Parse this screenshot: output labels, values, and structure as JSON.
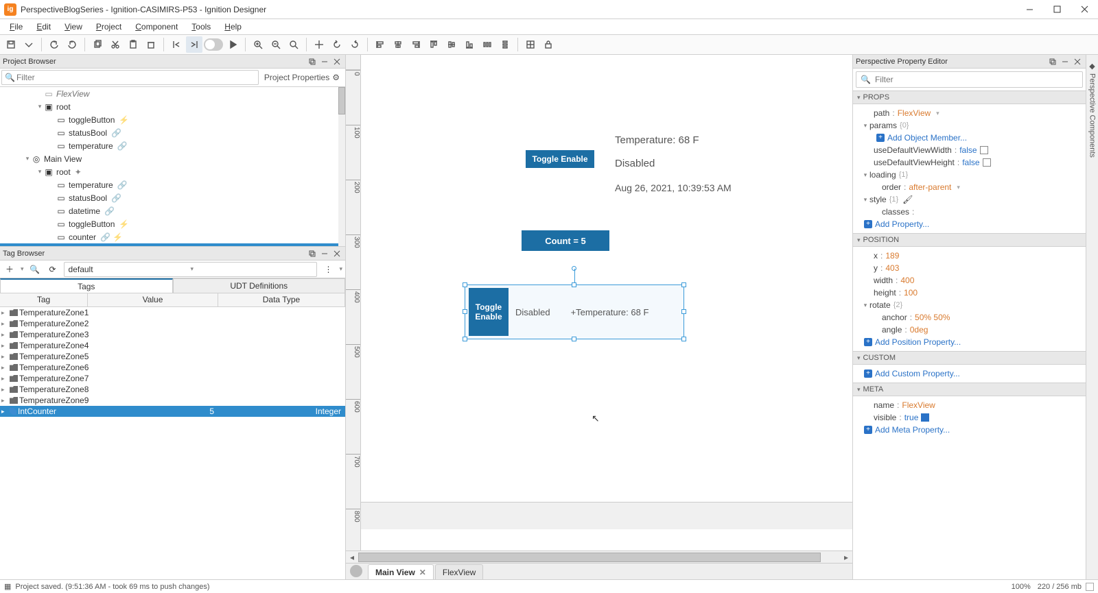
{
  "window": {
    "title": "PerspectiveBlogSeries - Ignition-CASIMIRS-P53 - Ignition Designer"
  },
  "menu": {
    "items": [
      "File",
      "Edit",
      "View",
      "Project",
      "Component",
      "Tools",
      "Help"
    ]
  },
  "toolbar": {
    "icons": [
      "save",
      "folder",
      "undo",
      "redo",
      "copy",
      "cut",
      "paste",
      "delete",
      "snap-left",
      "snap-right",
      "toggle",
      "play",
      "zoom-in",
      "zoom-out",
      "zoom-fit",
      "move",
      "rotate-left",
      "rotate-right",
      "align-left",
      "align-center",
      "align-right",
      "align-top",
      "align-middle",
      "align-bottom",
      "dist-h",
      "dist-v",
      "grid",
      "lock"
    ]
  },
  "projectBrowser": {
    "title": "Project Browser",
    "filterPlaceholder": "Filter",
    "projectPropsLabel": "Project Properties",
    "tree": [
      {
        "indent": 2,
        "caret": "",
        "label": "FlexView",
        "icon": "view",
        "fade": true
      },
      {
        "indent": 2,
        "caret": "▾",
        "label": "root",
        "icon": "container"
      },
      {
        "indent": 3,
        "caret": "",
        "label": "toggleButton",
        "icon": "comp",
        "badge": "⚡"
      },
      {
        "indent": 3,
        "caret": "",
        "label": "statusBool",
        "icon": "comp",
        "badge": "🔗"
      },
      {
        "indent": 3,
        "caret": "",
        "label": "temperature",
        "icon": "comp",
        "badge": "🔗"
      },
      {
        "indent": 1,
        "caret": "▾",
        "label": "Main View",
        "icon": "view-main"
      },
      {
        "indent": 2,
        "caret": "▾",
        "label": "root",
        "icon": "container",
        "badge": "✦"
      },
      {
        "indent": 3,
        "caret": "",
        "label": "temperature",
        "icon": "comp",
        "badge": "🔗"
      },
      {
        "indent": 3,
        "caret": "",
        "label": "statusBool",
        "icon": "comp",
        "badge": "🔗"
      },
      {
        "indent": 3,
        "caret": "",
        "label": "datetime",
        "icon": "comp",
        "badge": "🔗"
      },
      {
        "indent": 3,
        "caret": "",
        "label": "toggleButton",
        "icon": "comp",
        "badge": "⚡"
      },
      {
        "indent": 3,
        "caret": "",
        "label": "counter",
        "icon": "comp",
        "badge": "🔗 ⚡"
      },
      {
        "indent": 3,
        "caret": "",
        "label": "FlexView",
        "icon": "embed",
        "selected": true
      }
    ]
  },
  "tagBrowser": {
    "title": "Tag Browser",
    "provider": "default",
    "tabs": {
      "tags": "Tags",
      "udt": "UDT Definitions"
    },
    "headers": {
      "tag": "Tag",
      "value": "Value",
      "dt": "Data Type"
    },
    "rows": [
      {
        "kind": "folder",
        "name": "TemperatureZone1"
      },
      {
        "kind": "folder",
        "name": "TemperatureZone2"
      },
      {
        "kind": "folder",
        "name": "TemperatureZone3"
      },
      {
        "kind": "folder",
        "name": "TemperatureZone4"
      },
      {
        "kind": "folder",
        "name": "TemperatureZone5"
      },
      {
        "kind": "folder",
        "name": "TemperatureZone6"
      },
      {
        "kind": "folder",
        "name": "TemperatureZone7"
      },
      {
        "kind": "folder",
        "name": "TemperatureZone8"
      },
      {
        "kind": "folder",
        "name": "TemperatureZone9"
      },
      {
        "kind": "tag",
        "name": "IntCounter",
        "value": "5",
        "dt": "Integer",
        "selected": true
      }
    ]
  },
  "canvas": {
    "temperatureLabel": "Temperature: 68 F",
    "toggleEnable": "Toggle Enable",
    "disabled": "Disabled",
    "datetime": "Aug 26, 2021, 10:39:53 AM",
    "countBtn": "Count = 5",
    "flex": {
      "toggle": "Toggle Enable",
      "disabled": "Disabled",
      "temp": "+Temperature: 68 F"
    },
    "tabs": {
      "main": "Main View",
      "flex": "FlexView"
    }
  },
  "props": {
    "editorTitle": "Perspective Property Editor",
    "filterPlaceholder": "Filter",
    "sections": {
      "props": "PROPS",
      "position": "POSITION",
      "custom": "CUSTOM",
      "meta": "META"
    },
    "p": {
      "path_k": "path",
      "path_v": "FlexView",
      "params_k": "params",
      "params_c": "{0}",
      "addObj": "Add Object Member...",
      "udvw_k": "useDefaultViewWidth",
      "udvw_v": "false",
      "udvh_k": "useDefaultViewHeight",
      "udvh_v": "false",
      "loading_k": "loading",
      "loading_c": "{1}",
      "order_k": "order",
      "order_v": "after-parent",
      "style_k": "style",
      "style_c": "{1}",
      "classes_k": "classes",
      "classes_v": "",
      "addProp": "Add Property..."
    },
    "pos": {
      "x_k": "x",
      "x_v": "189",
      "y_k": "y",
      "y_v": "403",
      "w_k": "width",
      "w_v": "400",
      "h_k": "height",
      "h_v": "100",
      "rot_k": "rotate",
      "rot_c": "{2}",
      "anchor_k": "anchor",
      "anchor_v": "50% 50%",
      "angle_k": "angle",
      "angle_v": "0deg",
      "addPos": "Add Position Property..."
    },
    "custom": {
      "add": "Add Custom Property..."
    },
    "meta": {
      "name_k": "name",
      "name_v": "FlexView",
      "visible_k": "visible",
      "visible_v": "true",
      "add": "Add Meta Property..."
    }
  },
  "sidetab": {
    "label": "Perspective Components"
  },
  "status": {
    "message": "Project saved. (9:51:36 AM - took 69 ms to push changes)",
    "zoom": "100%",
    "mem": "220 / 256 mb"
  }
}
